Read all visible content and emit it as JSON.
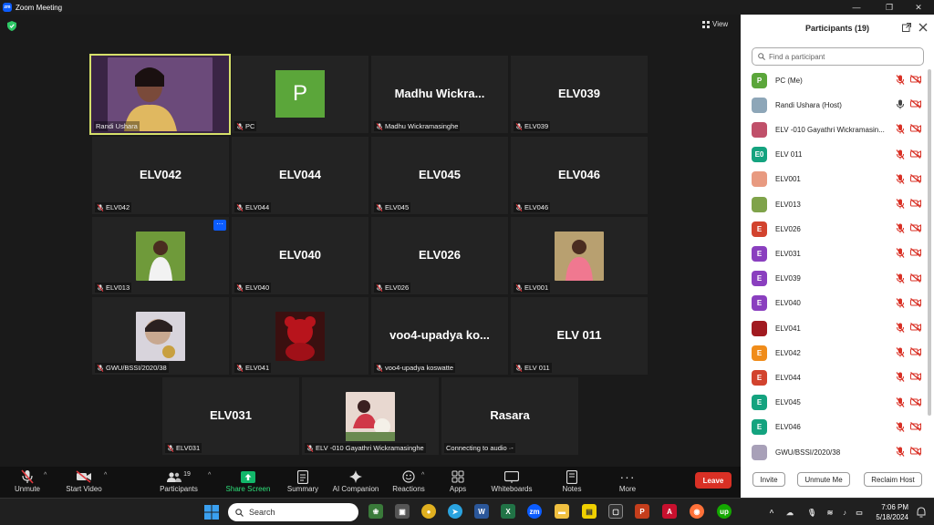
{
  "window": {
    "title": "Zoom Meeting",
    "minimize": "—",
    "maximize": "❐",
    "close": "✕"
  },
  "stage": {
    "view_label": "View"
  },
  "tiles": [
    {
      "label": "Randi Ushara",
      "big": ""
    },
    {
      "label": "PC",
      "big": "",
      "avatar_letter": "P"
    },
    {
      "label": "Madhu Wickramasinghe",
      "big": "Madhu  Wickra..."
    },
    {
      "label": "ELV039",
      "big": "ELV039"
    },
    {
      "label": "ELV042",
      "big": "ELV042"
    },
    {
      "label": "ELV044",
      "big": "ELV044"
    },
    {
      "label": "ELV045",
      "big": "ELV045"
    },
    {
      "label": "ELV046",
      "big": "ELV046"
    },
    {
      "label": "ELV013",
      "big": "",
      "more": "···"
    },
    {
      "label": "ELV040",
      "big": "ELV040"
    },
    {
      "label": "ELV026",
      "big": "ELV026"
    },
    {
      "label": "ELV001",
      "big": ""
    },
    {
      "label": "GWU/BSSI/2020/38",
      "big": ""
    },
    {
      "label": "ELV041",
      "big": ""
    },
    {
      "label": "voo4-upadya koswatte",
      "big": "voo4-upadya ko..."
    },
    {
      "label": "ELV 011",
      "big": "ELV 011"
    },
    {
      "label": "ELV031",
      "big": "ELV031"
    },
    {
      "label": "ELV -010 Gayathri Wickramasinghe",
      "big": ""
    },
    {
      "label": "Connecting to audio ·-",
      "big": "Rasara"
    }
  ],
  "controls": {
    "unmute": "Unmute",
    "start_video": "Start Video",
    "participants": "Participants",
    "participants_count": "19",
    "share_screen": "Share Screen",
    "summary": "Summary",
    "ai_companion": "AI Companion",
    "reactions": "Reactions",
    "apps": "Apps",
    "whiteboards": "Whiteboards",
    "notes": "Notes",
    "more": "More",
    "leave": "Leave"
  },
  "panel": {
    "title": "Participants (19)",
    "search_placeholder": "Find a participant",
    "participants": [
      {
        "name": "PC (Me)",
        "letter": "P",
        "color": "#5ba63a"
      },
      {
        "name": "Randi Ushara (Host)",
        "letter": "",
        "color": "#8da6b8"
      },
      {
        "name": "ELV -010 Gayathri Wickramasin...",
        "letter": "",
        "color": "#c0506a"
      },
      {
        "name": "ELV 011",
        "letter": "E0",
        "color": "#14a37f"
      },
      {
        "name": "ELV001",
        "letter": "",
        "color": "#e89a80"
      },
      {
        "name": "ELV013",
        "letter": "",
        "color": "#7fa34a"
      },
      {
        "name": "ELV026",
        "letter": "E",
        "color": "#d2432e"
      },
      {
        "name": "ELV031",
        "letter": "E",
        "color": "#8a3fbf"
      },
      {
        "name": "ELV039",
        "letter": "E",
        "color": "#8a3fbf"
      },
      {
        "name": "ELV040",
        "letter": "E",
        "color": "#8a3fbf"
      },
      {
        "name": "ELV041",
        "letter": "",
        "color": "#a11a20"
      },
      {
        "name": "ELV042",
        "letter": "E",
        "color": "#f08c1a"
      },
      {
        "name": "ELV044",
        "letter": "E",
        "color": "#d2432e"
      },
      {
        "name": "ELV045",
        "letter": "E",
        "color": "#14a37f"
      },
      {
        "name": "ELV046",
        "letter": "E",
        "color": "#14a37f"
      },
      {
        "name": "GWU/BSSI/2020/38",
        "letter": "",
        "color": "#a8a0b8"
      }
    ],
    "invite": "Invite",
    "unmute_me": "Unmute Me",
    "reclaim_host": "Reclaim Host"
  },
  "taskbar": {
    "search": "Search",
    "time": "7:06 PM",
    "date": "5/18/2024"
  }
}
